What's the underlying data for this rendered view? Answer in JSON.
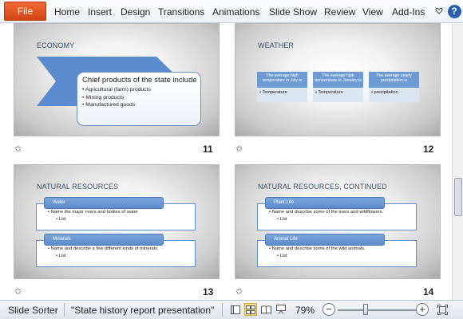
{
  "ribbon": {
    "file_label": "File",
    "tabs": [
      "Home",
      "Insert",
      "Design",
      "Transitions",
      "Animations",
      "Slide Show",
      "Review",
      "View",
      "Add-Ins"
    ],
    "help_label": "?"
  },
  "slides": {
    "s11": {
      "title": "ECONOMY",
      "number": "11",
      "callout_head": "Chief products of the state include",
      "bullets": [
        "Agricultural (farm) products",
        "Mining products",
        "Manufactured goods"
      ]
    },
    "s12": {
      "title": "WEATHER",
      "number": "12",
      "cols": [
        {
          "head": "The average high temperature in July is",
          "body": "Temperature"
        },
        {
          "head": "The average high temperature in January is",
          "body": "Temperature"
        },
        {
          "head": "The average yearly precipitation is",
          "body": "precipitation"
        }
      ]
    },
    "s13": {
      "title": "NATURAL RESOURCES",
      "number": "13",
      "blocks": [
        {
          "tab": "Water",
          "line": "Name the major rivers and bodies of water",
          "sub": "List"
        },
        {
          "tab": "Minerals",
          "line": "Name and describe a few different kinds of minerals.",
          "sub": "List"
        }
      ]
    },
    "s14": {
      "title": "NATURAL RESOURCES, CONTINUED",
      "number": "14",
      "blocks": [
        {
          "tab": "Plant Life",
          "line": "Name and describe some of the trees and wildflowers.",
          "sub": "List"
        },
        {
          "tab": "Animal Life",
          "line": "Name and describe some of the wild animals.",
          "sub": "List"
        }
      ]
    }
  },
  "status": {
    "view_name": "Slide Sorter",
    "theme_name": "\"State history report presentation\"",
    "zoom": "79%",
    "zoom_out": "−",
    "zoom_in": "+"
  },
  "colors": {
    "file_tab": "#d24512",
    "shape_blue": "#5c8ccb",
    "active_view": "#fde38a"
  }
}
